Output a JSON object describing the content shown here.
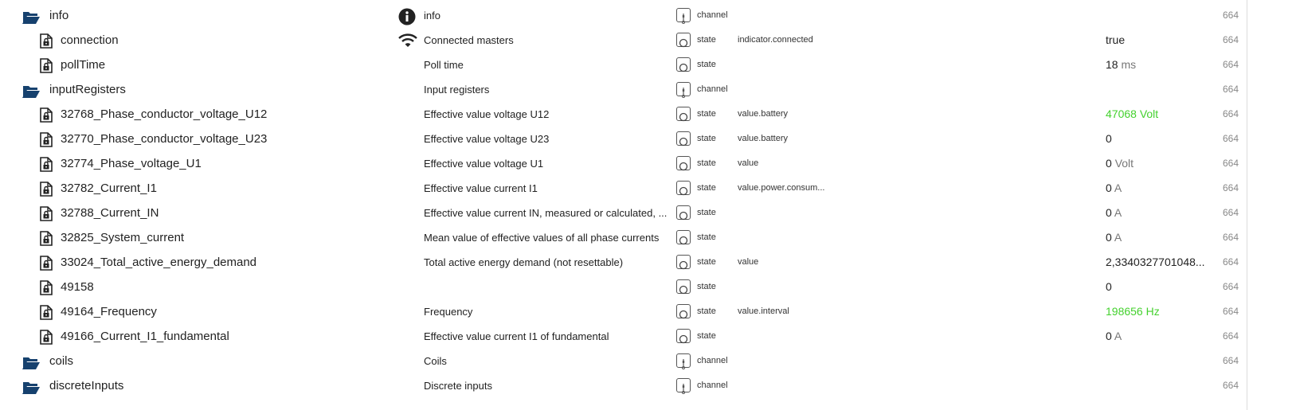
{
  "colors": {
    "folder": "#16416e",
    "value_ok": "#44d12e",
    "text": "#222222",
    "muted": "#888888"
  },
  "rows": [
    {
      "kind": "folder",
      "id": "info",
      "icon": "info-circle-icon",
      "name": "info",
      "type": "channel",
      "role": "",
      "value": "",
      "unit": "",
      "acl": "664"
    },
    {
      "kind": "file",
      "id": "connection",
      "icon": "wifi-icon",
      "name": "Connected masters",
      "type": "state",
      "role": "indicator.connected",
      "value": "true",
      "unit": "",
      "acl": "664"
    },
    {
      "kind": "file",
      "id": "pollTime",
      "icon": "",
      "name": "Poll time",
      "type": "state",
      "role": "",
      "value": "18",
      "unit": "ms",
      "acl": "664"
    },
    {
      "kind": "folder",
      "id": "inputRegisters",
      "icon": "",
      "name": "Input registers",
      "type": "channel",
      "role": "",
      "value": "",
      "unit": "",
      "acl": "664"
    },
    {
      "kind": "file",
      "id": "32768_Phase_conductor_voltage_U12",
      "icon": "",
      "name": "Effective value voltage U12",
      "type": "state",
      "role": "value.battery",
      "value": "47068",
      "unit": "Volt",
      "green": true,
      "acl": "664"
    },
    {
      "kind": "file",
      "id": "32770_Phase_conductor_voltage_U23",
      "icon": "",
      "name": "Effective value voltage U23",
      "type": "state",
      "role": "value.battery",
      "value": "0",
      "unit": "",
      "acl": "664"
    },
    {
      "kind": "file",
      "id": "32774_Phase_voltage_U1",
      "icon": "",
      "name": "Effective value voltage U1",
      "type": "state",
      "role": "value",
      "value": "0",
      "unit": "Volt",
      "acl": "664"
    },
    {
      "kind": "file",
      "id": "32782_Current_I1",
      "icon": "",
      "name": "Effective value current I1",
      "type": "state",
      "role": "value.power.consum...",
      "value": "0",
      "unit": "A",
      "acl": "664"
    },
    {
      "kind": "file",
      "id": "32788_Current_IN",
      "icon": "",
      "name": "Effective value current IN, measured or calculated, ...",
      "type": "state",
      "role": "",
      "value": "0",
      "unit": "A",
      "acl": "664"
    },
    {
      "kind": "file",
      "id": "32825_System_current",
      "icon": "",
      "name": "Mean value of effective values of all phase currents",
      "type": "state",
      "role": "",
      "value": "0",
      "unit": "A",
      "acl": "664"
    },
    {
      "kind": "file",
      "id": "33024_Total_active_energy_demand",
      "icon": "",
      "name": "Total active energy demand (not resettable)",
      "type": "state",
      "role": "value",
      "value": "2,3340327701048...",
      "unit": "",
      "acl": "664"
    },
    {
      "kind": "file",
      "id": "49158",
      "icon": "",
      "name": "",
      "type": "state",
      "role": "",
      "value": "0",
      "unit": "",
      "acl": "664"
    },
    {
      "kind": "file",
      "id": "49164_Frequency",
      "icon": "",
      "name": "Frequency",
      "type": "state",
      "role": "value.interval",
      "value": "198656",
      "unit": "Hz",
      "green": true,
      "acl": "664"
    },
    {
      "kind": "file",
      "id": "49166_Current_I1_fundamental",
      "icon": "",
      "name": "Effective value current I1 of fundamental",
      "type": "state",
      "role": "",
      "value": "0",
      "unit": "A",
      "acl": "664"
    },
    {
      "kind": "folder",
      "id": "coils",
      "icon": "",
      "name": "Coils",
      "type": "channel",
      "role": "",
      "value": "",
      "unit": "",
      "acl": "664"
    },
    {
      "kind": "folder",
      "id": "discreteInputs",
      "icon": "",
      "name": "Discrete inputs",
      "type": "channel",
      "role": "",
      "value": "",
      "unit": "",
      "acl": "664"
    }
  ]
}
